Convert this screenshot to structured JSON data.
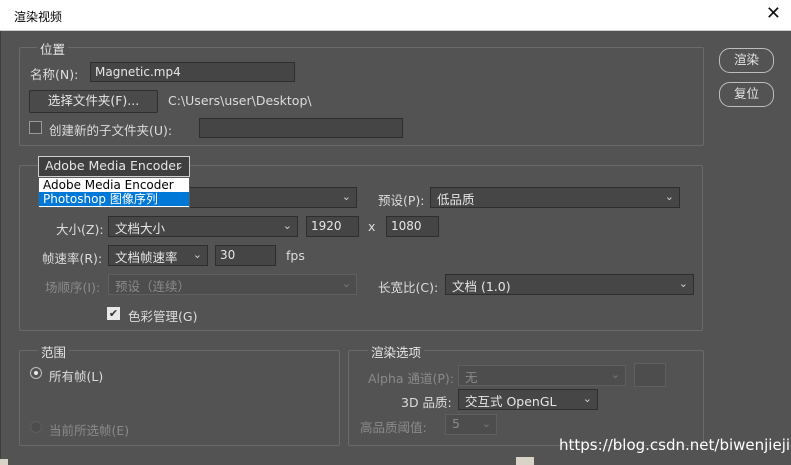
{
  "window": {
    "title": "渲染视频",
    "close_glyph": "✕"
  },
  "side_buttons": {
    "render": "渲染",
    "reset": "复位"
  },
  "location": {
    "legend": "位置",
    "name_label": "名称(N):",
    "name_value": "Magnetic.mp4",
    "choose_folder_button": "选择文件夹(F)...",
    "path": "C:\\Users\\user\\Desktop\\",
    "create_subfolder_label": "创建新的子文件夹(U):",
    "create_subfolder_checked": false,
    "subfolder_value": ""
  },
  "encoder": {
    "selected": "Adobe Media Encoder",
    "options": [
      "Adobe Media Encoder",
      "Photoshop 图像序列"
    ],
    "highlighted_option": "Photoshop 图像序列"
  },
  "format": {
    "preset_label": "预设(P):",
    "preset_value": "低品质",
    "size_label": "大小(Z):",
    "size_value": "文档大小",
    "width": "1920",
    "times": "x",
    "height": "1080",
    "framerate_label": "帧速率(R):",
    "framerate_value": "文档帧速率",
    "fps_value": "30",
    "fps_unit": "fps",
    "field_order_label": "场顺序(I):",
    "field_order_value": "预设（连续）",
    "aspect_label": "长宽比(C):",
    "aspect_value": "文档 (1.0)",
    "color_mgmt_label": "色彩管理(G)",
    "color_mgmt_checked": true
  },
  "range": {
    "legend": "范围",
    "all_frames": "所有帧(L)",
    "current_selected": "当前所选帧(E)"
  },
  "render_options": {
    "legend": "渲染选项",
    "alpha_label": "Alpha 通道(P):",
    "alpha_value": "无",
    "quality_label": "3D 品质:",
    "quality_value": "交互式 OpenGL",
    "threshold_label": "高品质阈值:",
    "threshold_value": "5"
  },
  "watermark": "https://blog.csdn.net/biwenjiejie"
}
